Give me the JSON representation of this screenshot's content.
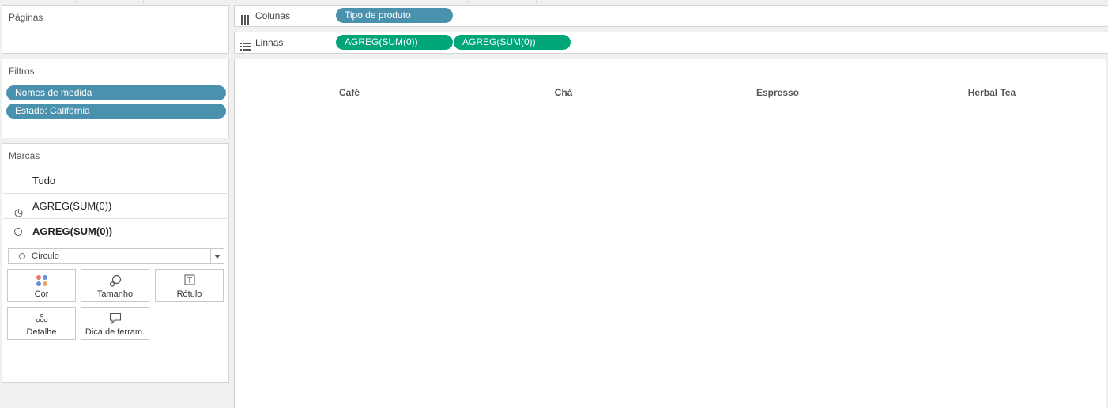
{
  "pages_panel": {
    "title": "Páginas"
  },
  "filters_panel": {
    "title": "Filtros",
    "pills": [
      "Nomes de medida",
      "Estado: Califórnia"
    ]
  },
  "marks_panel": {
    "title": "Marcas",
    "rows": [
      {
        "label": "Tudo",
        "icon": "none"
      },
      {
        "label": "AGREG(SUM(0))",
        "icon": "pie-icon"
      },
      {
        "label": "AGREG(SUM(0))",
        "icon": "circle-icon",
        "bold": true
      }
    ],
    "mark_type": "Círculo",
    "buttons": {
      "color": "Cor",
      "size": "Tamanho",
      "label": "Rótulo",
      "detail": "Detalhe",
      "tooltip": "Dica de ferram."
    }
  },
  "columns_shelf": {
    "label": "Colunas",
    "pills": [
      "Tipo de produto"
    ]
  },
  "rows_shelf": {
    "label": "Linhas",
    "pills": [
      "AGREG(SUM(0))",
      "AGREG(SUM(0))"
    ]
  },
  "view": {
    "column_headers": [
      "Café",
      "Chá",
      "Espresso",
      "Herbal Tea"
    ]
  },
  "colors": {
    "dimension_pill": "#4a91ae",
    "measure_pill": "#00a578"
  }
}
